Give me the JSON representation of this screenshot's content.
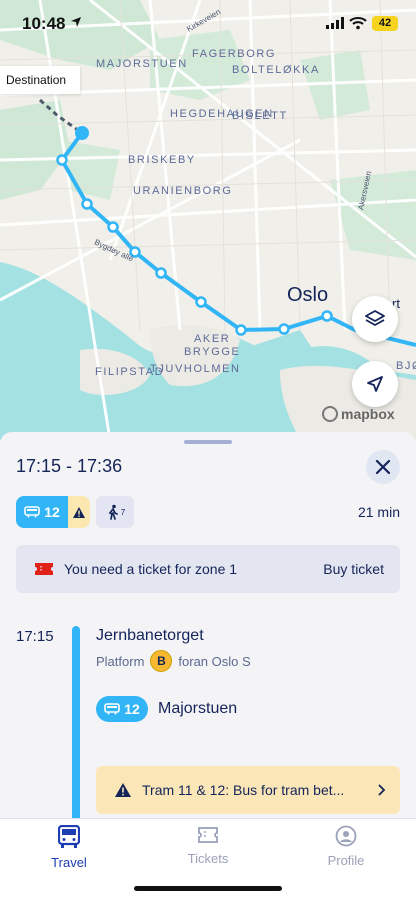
{
  "status": {
    "time": "10:48",
    "battery": "42"
  },
  "map": {
    "destination_label": "Destination",
    "districts": [
      "MAJORSTUEN",
      "FAGERBORG",
      "BOLTELØKKA",
      "HEGDEHAUGEN",
      "BISLETT",
      "BRISKEBY",
      "URANIENBORG",
      "AKER",
      "BRYGGE",
      "FILIPSTAD",
      "TJUVHOLMEN",
      "BJØ"
    ],
    "roads": [
      "Kirkeveien",
      "Bygdøy allé",
      "Akersveien"
    ],
    "city": "Oslo",
    "map_btn_partial": "rt",
    "attribution": "mapbox"
  },
  "trip": {
    "time_range": "17:15 - 17:36",
    "tram_line": "12",
    "walk_minutes": "7",
    "duration": "21 min"
  },
  "ticket_banner": {
    "message": "You need a ticket for zone 1",
    "action": "Buy ticket"
  },
  "departure": {
    "time": "17:15",
    "stop": "Jernbanetorget",
    "platform_label": "Platform",
    "platform_code": "B",
    "platform_desc": "foran Oslo S",
    "line": "12",
    "line_destination": "Majorstuen"
  },
  "alert": {
    "text": "Tram 11 & 12: Bus for tram bet..."
  },
  "tabs": [
    {
      "label": "Travel",
      "active": true
    },
    {
      "label": "Tickets",
      "active": false
    },
    {
      "label": "Profile",
      "active": false
    }
  ],
  "colors": {
    "accent": "#32b5f6",
    "navy": "#142459",
    "warning": "#fbe6b7",
    "active_tab": "#1f3db3"
  }
}
